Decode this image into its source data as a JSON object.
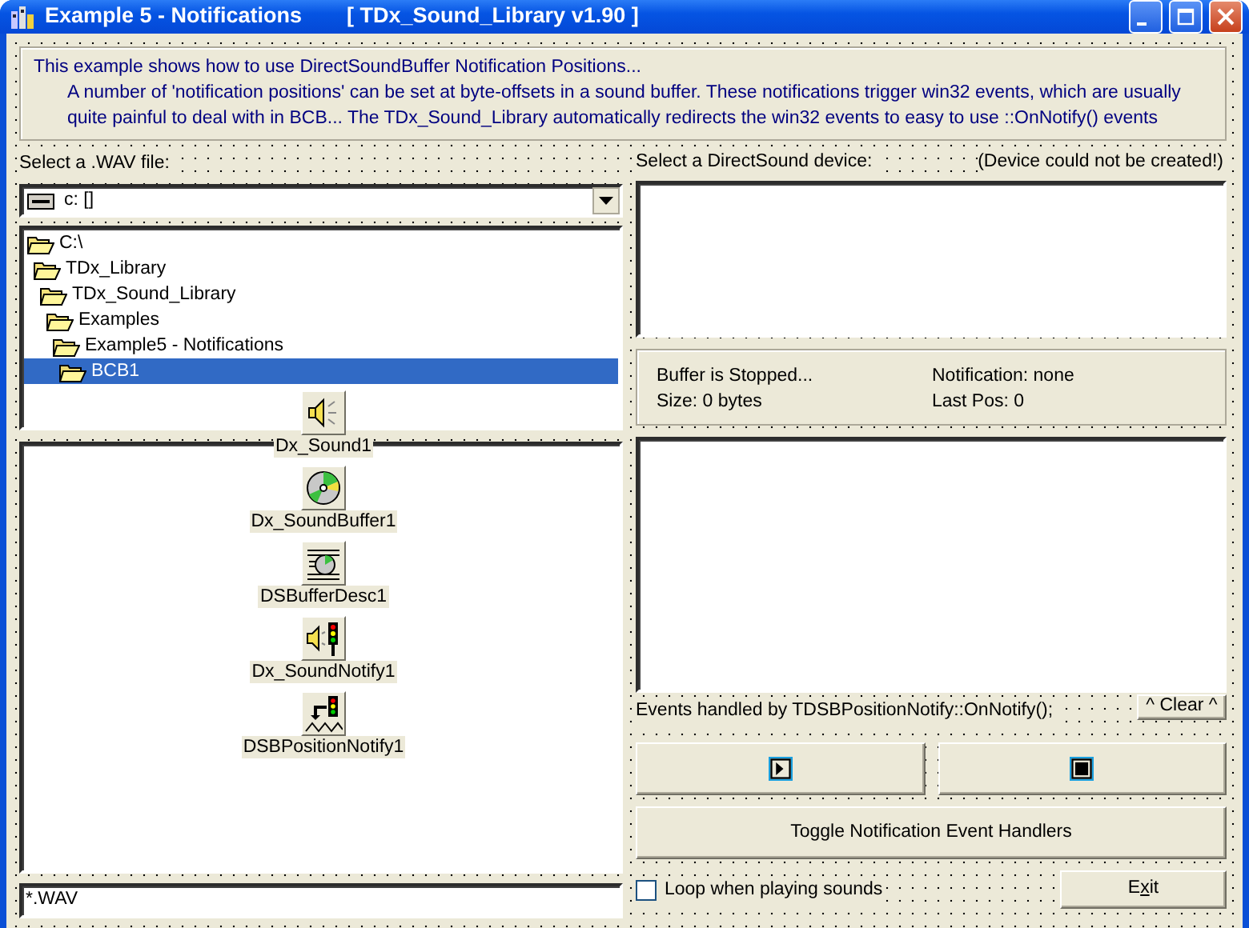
{
  "window": {
    "title": "Example 5 - Notifications",
    "version": "[ TDx_Sound_Library v1.90 ]"
  },
  "info": {
    "heading": "This example shows how to use DirectSoundBuffer Notification Positions...",
    "body": "A number of 'notification positions' can be set at byte-offsets in a sound buffer. These notifications trigger win32 events, which are usually quite painful to deal with in BCB... The TDx_Sound_Library automatically redirects the win32 events to easy to use ::OnNotify() events"
  },
  "file_panel": {
    "label": "Select a .WAV file:",
    "drive": "c: []",
    "folders": [
      {
        "name": "C:\\",
        "selected": false,
        "children": [
          {
            "name": "TDx_Library",
            "selected": false,
            "children": [
              {
                "name": "TDx_Sound_Library",
                "selected": false,
                "children": [
                  {
                    "name": "Examples",
                    "selected": false,
                    "children": [
                      {
                        "name": "Example5 - Notifications",
                        "selected": false,
                        "children": [
                          {
                            "name": "BCB1",
                            "selected": true
                          }
                        ]
                      }
                    ]
                  }
                ]
              }
            ]
          }
        ]
      }
    ],
    "filter": "*.WAV"
  },
  "components": [
    {
      "name": "Dx_Sound1",
      "kind": "sound"
    },
    {
      "name": "Dx_SoundBuffer1",
      "kind": "buffer"
    },
    {
      "name": "DSBufferDesc1",
      "kind": "desc"
    },
    {
      "name": "Dx_SoundNotify1",
      "kind": "notify"
    },
    {
      "name": "DSBPositionNotify1",
      "kind": "position"
    }
  ],
  "device_panel": {
    "label": "Select a DirectSound device:",
    "error": "(Device could not be created!)"
  },
  "status": {
    "state": "Buffer is Stopped...",
    "size": "Size: 0 bytes",
    "notification": "Notification: none",
    "last_pos": "Last Pos: 0"
  },
  "events": {
    "label": "Events handled by TDSBPositionNotify::OnNotify();",
    "clear_button": "^ Clear ^"
  },
  "transport": [
    {
      "kind": "play"
    },
    {
      "kind": "stop"
    }
  ],
  "toggle_button": "Toggle Notification Event Handlers",
  "loop": {
    "label": "Loop when playing sounds",
    "checked": false
  },
  "exit_button": {
    "before_key": "E",
    "access_key": "x",
    "after_key": "it"
  }
}
